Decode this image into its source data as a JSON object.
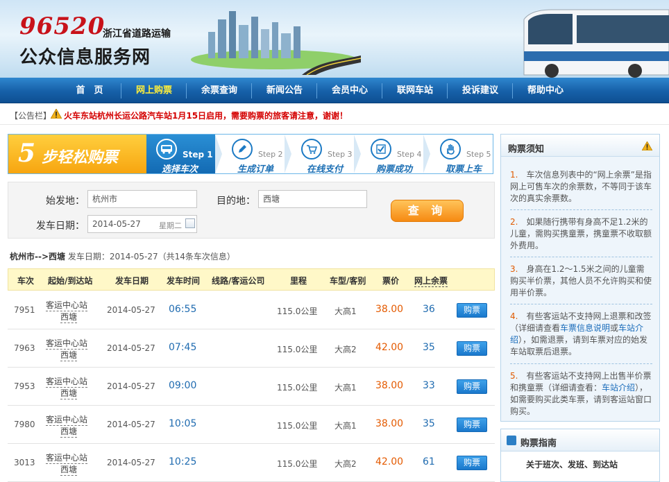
{
  "header": {
    "hotline": "96520",
    "province_org": "浙江省道路运输",
    "site_title": "公众信息服务网"
  },
  "nav": {
    "items": [
      {
        "label": "首　页"
      },
      {
        "label": "网上购票"
      },
      {
        "label": "余票查询"
      },
      {
        "label": "新闻公告"
      },
      {
        "label": "会员中心"
      },
      {
        "label": "联网车站"
      },
      {
        "label": "投诉建议"
      },
      {
        "label": "帮助中心"
      }
    ],
    "active_index": 1
  },
  "notice": {
    "label": "【公告栏】",
    "text": "火车东站杭州长运公路汽车站1月15日启用，需要购票的旅客请注意，谢谢！"
  },
  "steps": {
    "badge_num": "5",
    "badge_text": "步轻松购票",
    "items": [
      {
        "step": "Step 1",
        "label": "选择车次",
        "icon": "bus-icon"
      },
      {
        "step": "Step 2",
        "label": "生成订单",
        "icon": "pencil-icon"
      },
      {
        "step": "Step 3",
        "label": "在线支付",
        "icon": "cart-icon"
      },
      {
        "step": "Step 4",
        "label": "购票成功",
        "icon": "check-icon"
      },
      {
        "step": "Step 5",
        "label": "取票上车",
        "icon": "hand-icon"
      }
    ]
  },
  "search": {
    "from_label": "始发地：",
    "from_value": "杭州市",
    "to_label": "目的地：",
    "to_value": "西塘",
    "date_label": "发车日期：",
    "date_value": "2014-05-27",
    "weekday": "星期二",
    "submit_label": "查 询"
  },
  "result_info": {
    "route": "杭州市-->西塘",
    "detail": " 发车日期：2014-05-27（共14条车次信息）"
  },
  "table": {
    "columns": [
      "车次",
      "起始/到达站",
      "发车日期",
      "发车时间",
      "线路/客运公司",
      "里程",
      "车型/客别",
      "票价",
      "网上余票"
    ],
    "rows": [
      {
        "no": "7951",
        "from": "客运中心站",
        "to": "西塘",
        "date": "2014-05-27",
        "time": "06:55",
        "distance": "115.0公里",
        "type": "大高1",
        "price": "38.00",
        "remaining": "36",
        "buy": "购票"
      },
      {
        "no": "7963",
        "from": "客运中心站",
        "to": "西塘",
        "date": "2014-05-27",
        "time": "07:45",
        "distance": "115.0公里",
        "type": "大高2",
        "price": "42.00",
        "remaining": "35",
        "buy": "购票"
      },
      {
        "no": "7953",
        "from": "客运中心站",
        "to": "西塘",
        "date": "2014-05-27",
        "time": "09:00",
        "distance": "115.0公里",
        "type": "大高1",
        "price": "38.00",
        "remaining": "33",
        "buy": "购票"
      },
      {
        "no": "7980",
        "from": "客运中心站",
        "to": "西塘",
        "date": "2014-05-27",
        "time": "10:05",
        "distance": "115.0公里",
        "type": "大高1",
        "price": "38.00",
        "remaining": "35",
        "buy": "购票"
      },
      {
        "no": "3013",
        "from": "客运中心站",
        "to": "西塘",
        "date": "2014-05-27",
        "time": "10:25",
        "distance": "115.0公里",
        "type": "大高2",
        "price": "42.00",
        "remaining": "61",
        "buy": "购票"
      }
    ]
  },
  "notes": {
    "title": "购票须知",
    "items": [
      {
        "n": "1.",
        "text": "车次信息列表中的“网上余票”是指网上可售车次的余票数，不等同于该车次的真实余票数。"
      },
      {
        "n": "2.",
        "text": "如果随行携带有身高不足1.2米的儿童，需购买携童票，携童票不收取额外费用。"
      },
      {
        "n": "3.",
        "text": "身高在1.2～1.5米之间的儿童需购买半价票，其他人员不允许购买和使用半价票。"
      },
      {
        "n": "4.",
        "text_a": "有些客运站不支持网上退票和改签（详细请查看",
        "link_a": "车票信息说明",
        "text_b": "或",
        "link_b": "车站介绍",
        "text_c": "），如需退票，请到车票对应的始发车站取票后退票。"
      },
      {
        "n": "5.",
        "text_a": "有些客运站不支持网上出售半价票和携童票（详细请查看：",
        "link_a": "车站介绍",
        "text_c": "），如需要购买此类车票，请到客运站窗口购买。"
      }
    ]
  },
  "news": {
    "title": "购票指南",
    "item": "关于班次、发班、到达站"
  },
  "colors": {
    "nav_bg": "#1660a8",
    "nav_active": "#ffef3a",
    "notice_text": "#d40000",
    "price": "#e45a00",
    "link": "#1a6cba",
    "buy_button": "#1a78cc",
    "search_button": "#f68a12"
  }
}
